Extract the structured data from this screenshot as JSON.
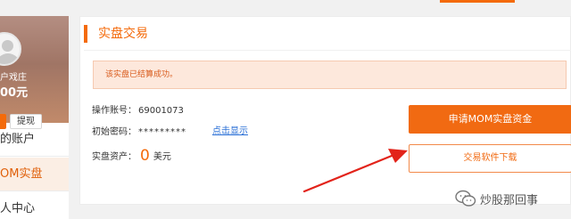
{
  "sidebar": {
    "user_name": "户戏庄",
    "balance": "00元",
    "withdraw_label": "提现",
    "nav": {
      "account": "的账户",
      "mom": "OM实盘",
      "center": "人中心"
    }
  },
  "panel": {
    "title": "实盘交易",
    "alert": "该实盘已结算成功。",
    "account_label": "操作账号：",
    "account_value": "69001073",
    "password_label": "初始密码：",
    "password_value": "*********",
    "show_link": "点击显示",
    "assets_label": "实盘资产：",
    "assets_value": "0",
    "assets_unit": "美元",
    "apply_button": "申请MOM实盘资金",
    "download_button": "交易软件下载"
  },
  "watermark": {
    "text": "炒股那回事",
    "icon": "wechat-icon"
  },
  "colors": {
    "accent": "#f46a0a",
    "link": "#2a6fd6",
    "alert_bg": "#fde8dc",
    "arrow": "#e2231a"
  }
}
